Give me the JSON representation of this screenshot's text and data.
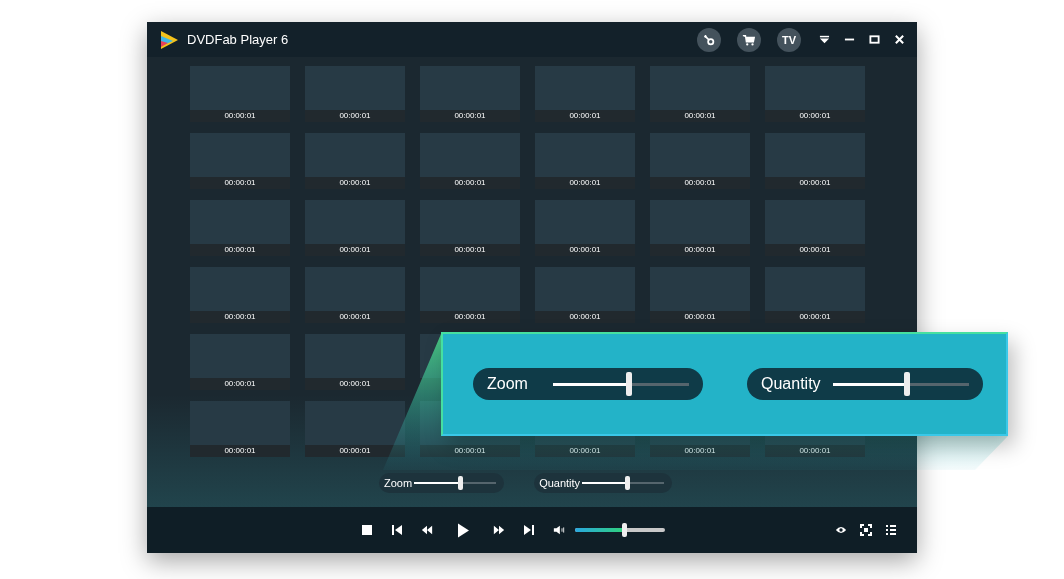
{
  "window": {
    "title": "DVDFab Player 6",
    "header_buttons": [
      {
        "kind": "key"
      },
      {
        "kind": "cart"
      },
      {
        "kind": "text",
        "label": "TV"
      }
    ]
  },
  "thumbnails": {
    "rows": [
      {
        "times": [
          "00:00:01",
          "00:00:01",
          "00:00:01",
          "00:00:01",
          "00:00:01",
          "00:00:01"
        ]
      },
      {
        "times": [
          "00:00:01",
          "00:00:01",
          "00:00:01",
          "00:00:01",
          "00:00:01",
          "00:00:01"
        ]
      },
      {
        "times": [
          "00:00:01",
          "00:00:01",
          "00:00:01",
          "00:00:01",
          "00:00:01",
          "00:00:01"
        ]
      },
      {
        "times": [
          "00:00:01",
          "00:00:01",
          "00:00:01",
          "00:00:01",
          "00:00:01",
          "00:00:01"
        ]
      },
      {
        "times": [
          "00:00:01",
          "00:00:01"
        ]
      },
      {
        "times": [
          "00:00:01",
          "00:00:01",
          "00:00:01",
          "00:00:01",
          "00:00:01",
          "00:00:01"
        ]
      }
    ]
  },
  "sliders": [
    {
      "label": "Zoom",
      "level": 0.56
    },
    {
      "label": "Quantity",
      "level": 0.55
    }
  ],
  "callout": {
    "sliders": [
      {
        "label": "Zoom",
        "level": 0.56
      },
      {
        "label": "Quantity",
        "level": 0.55
      }
    ]
  },
  "controls": {
    "volume": {
      "level": 0.55
    }
  }
}
